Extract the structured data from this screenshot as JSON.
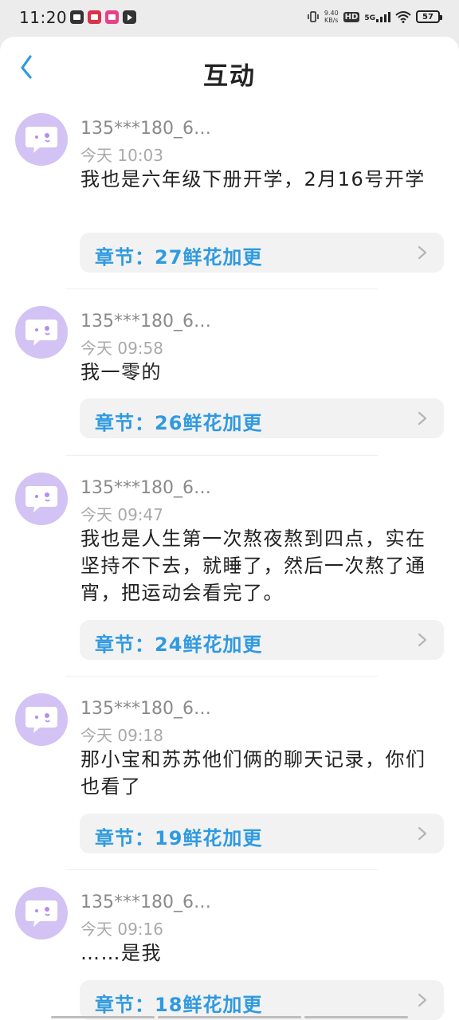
{
  "status_bar": {
    "time": "11:20",
    "net_speed_value": "9.40",
    "net_speed_unit": "KB/s",
    "hd": "HD",
    "network": "5G",
    "battery": "57"
  },
  "header": {
    "title": "互动"
  },
  "comments": [
    {
      "username": "135***180_6…",
      "time": "今天 10:03",
      "text": "我也是六年级下册开学，2月16号开学",
      "chapter": "章节：27鲜花加更"
    },
    {
      "username": "135***180_6…",
      "time": "今天 09:58",
      "text": "我一零的",
      "chapter": "章节：26鲜花加更"
    },
    {
      "username": "135***180_6…",
      "time": "今天 09:47",
      "text": "我也是人生第一次熬夜熬到四点，实在坚持不下去，就睡了，然后一次熬了通宵，把运动会看完了。",
      "chapter": "章节：24鲜花加更"
    },
    {
      "username": "135***180_6…",
      "time": "今天 09:18",
      "text": "那小宝和苏苏他们俩的聊天记录，你们也看了",
      "chapter": "章节：19鲜花加更"
    },
    {
      "username": "135***180_6…",
      "time": "今天 09:16",
      "text": "……是我",
      "chapter": "章节：18鲜花加更"
    }
  ],
  "colors": {
    "accent": "#2f9ae0",
    "avatar_bg": "#d3c2f4",
    "avatar_icon": "#b48df0"
  },
  "icons": {
    "back": "chevron-left-icon",
    "row_arrow": "chevron-right-icon",
    "avatar": "chat-bubble-icon"
  }
}
